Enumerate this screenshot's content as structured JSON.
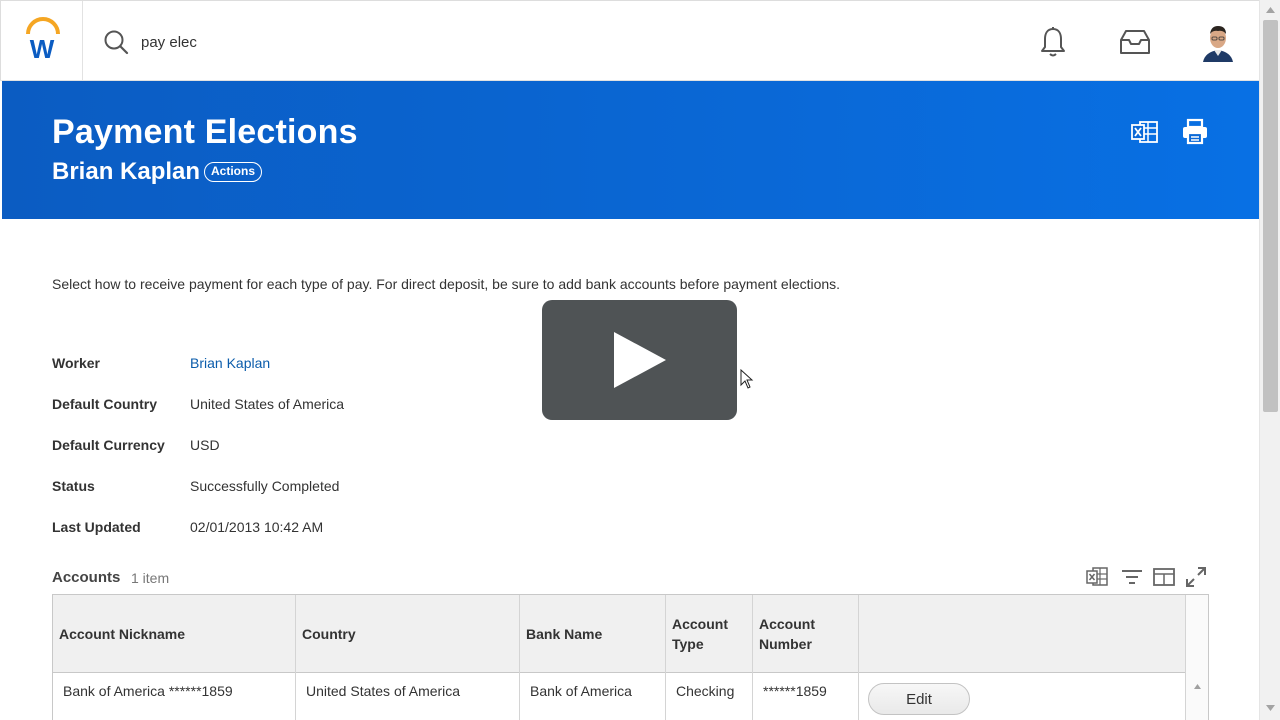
{
  "search": {
    "value": "pay elec"
  },
  "header": {
    "title": "Payment Elections",
    "worker_name": "Brian Kaplan",
    "actions_label": "Actions"
  },
  "intro_text": "Select how to receive payment for each type of pay. For direct deposit, be sure to add bank accounts before payment elections.",
  "fields": [
    {
      "label": "Worker",
      "value": "Brian Kaplan"
    },
    {
      "label": "Default Country",
      "value": "United States of America"
    },
    {
      "label": "Default Currency",
      "value": "USD"
    },
    {
      "label": "Status",
      "value": "Successfully Completed"
    },
    {
      "label": "Last Updated",
      "value": "02/01/2013 10:42 AM"
    }
  ],
  "accounts": {
    "title": "Accounts",
    "count": "1 item",
    "columns": [
      "Account Nickname",
      "Country",
      "Bank Name",
      "Account Type",
      "Account Number"
    ],
    "rows": [
      {
        "nickname": "Bank of America ******1859",
        "country": "United States of America",
        "bank_name": "Bank of America",
        "account_type": "Checking",
        "account_number": "******1859",
        "edit_label": "Edit"
      }
    ]
  },
  "icons": {
    "logo": "workday-logo",
    "search": "search-icon",
    "notifications": "bell-icon",
    "inbox": "inbox-icon",
    "avatar": "avatar",
    "excel": "excel-export-icon",
    "print": "print-icon",
    "filter": "filter-icon",
    "columns": "columns-icon",
    "fullscreen": "fullscreen-icon",
    "play": "play-icon"
  },
  "colors": {
    "brand_blue": "#0b5cc2",
    "link": "#0b5cab",
    "logo_orange": "#f5a623",
    "logo_blue": "#0b5cc2"
  }
}
